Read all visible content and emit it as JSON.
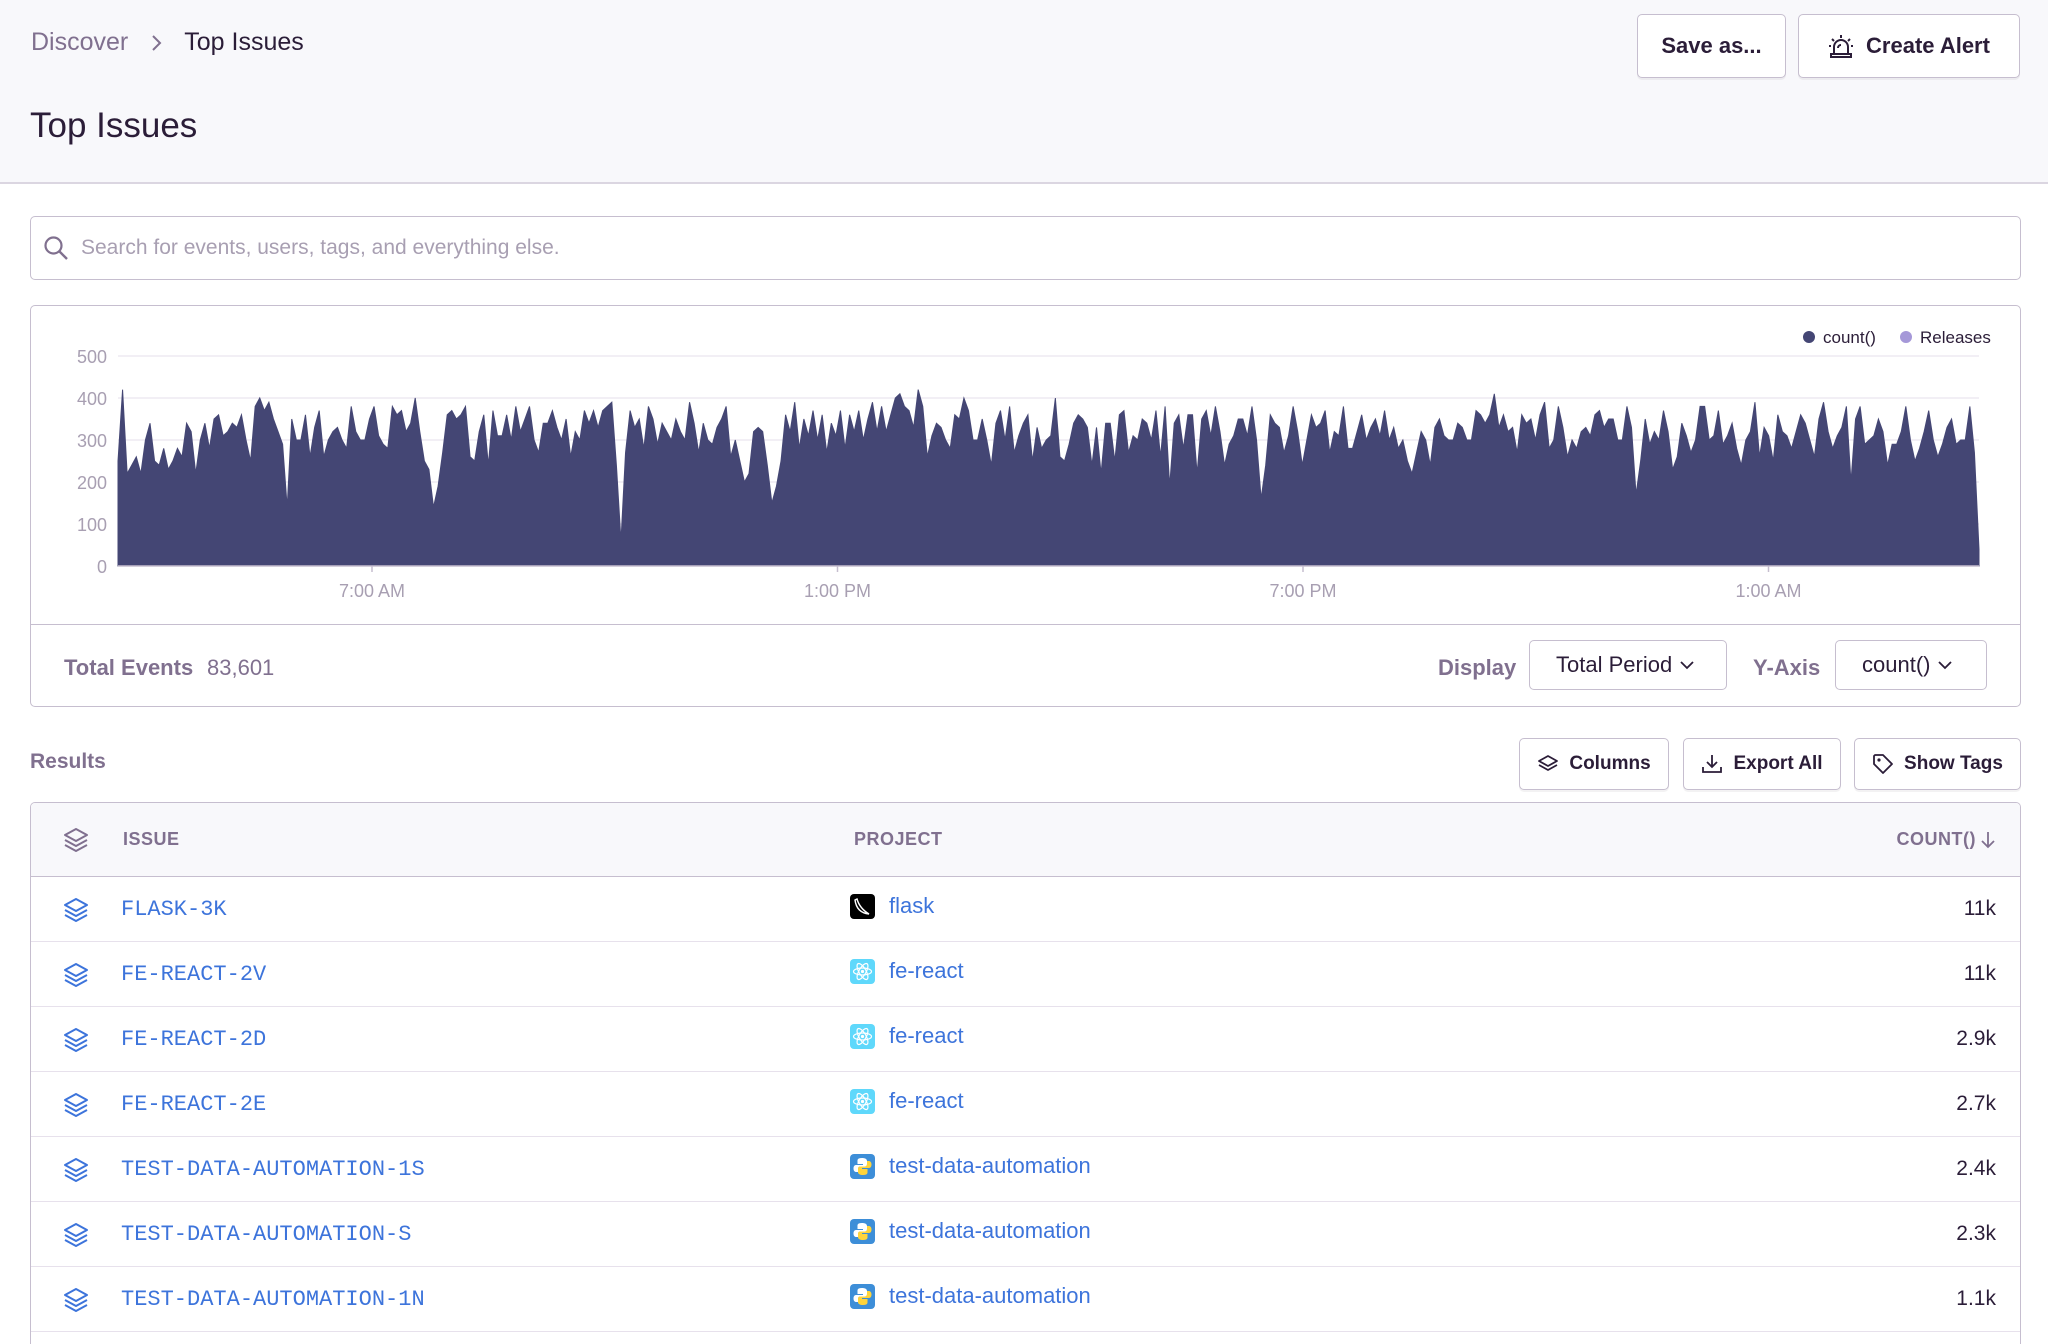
{
  "breadcrumb": {
    "parent": "Discover",
    "current": "Top Issues"
  },
  "page_title": "Top Issues",
  "header_buttons": {
    "save": "Save as...",
    "alert": "Create Alert"
  },
  "search": {
    "placeholder": "Search for events, users, tags, and everything else."
  },
  "chart_data": {
    "type": "area",
    "legend": [
      "count()",
      "Releases"
    ],
    "legend_colors": [
      "#444674",
      "#a598d8"
    ],
    "y_ticks": [
      "500",
      "400",
      "300",
      "200",
      "100",
      "0"
    ],
    "ylim": [
      0,
      500
    ],
    "x_ticks": [
      "7:00 AM",
      "1:00 PM",
      "7:00 PM",
      "1:00 AM"
    ],
    "series": [
      {
        "name": "count()",
        "color": "#444674",
        "values": [
          250,
          420,
          220,
          240,
          260,
          220,
          300,
          340,
          250,
          240,
          280,
          230,
          250,
          280,
          260,
          340,
          320,
          220,
          300,
          340,
          280,
          350,
          360,
          310,
          320,
          340,
          330,
          360,
          300,
          250,
          380,
          400,
          370,
          390,
          350,
          320,
          290,
          140,
          350,
          300,
          300,
          360,
          260,
          330,
          370,
          260,
          300,
          320,
          330,
          300,
          280,
          380,
          320,
          300,
          300,
          350,
          380,
          310,
          290,
          280,
          380,
          360,
          370,
          320,
          340,
          400,
          320,
          250,
          230,
          140,
          190,
          270,
          360,
          370,
          350,
          360,
          380,
          260,
          250,
          320,
          360,
          240,
          370,
          310,
          310,
          360,
          300,
          380,
          320,
          350,
          380,
          300,
          270,
          340,
          340,
          370,
          330,
          300,
          350,
          260,
          320,
          300,
          370,
          340,
          370,
          330,
          370,
          380,
          390,
          240,
          60,
          270,
          370,
          330,
          350,
          280,
          380,
          350,
          290,
          340,
          320,
          300,
          350,
          320,
          300,
          390,
          340,
          270,
          340,
          300,
          290,
          330,
          350,
          380,
          260,
          300,
          250,
          200,
          220,
          320,
          330,
          320,
          240,
          150,
          190,
          250,
          360,
          320,
          390,
          280,
          350,
          310,
          370,
          300,
          360,
          270,
          340,
          310,
          370,
          280,
          360,
          320,
          370,
          300,
          350,
          390,
          320,
          380,
          320,
          360,
          400,
          410,
          380,
          370,
          330,
          420,
          380,
          260,
          310,
          340,
          330,
          300,
          280,
          360,
          350,
          400,
          370,
          300,
          300,
          350,
          300,
          240,
          340,
          370,
          300,
          380,
          270,
          310,
          340,
          360,
          250,
          330,
          280,
          300,
          310,
          400,
          260,
          250,
          290,
          340,
          360,
          350,
          330,
          240,
          330,
          220,
          340,
          340,
          250,
          360,
          370,
          270,
          310,
          300,
          350,
          340,
          300,
          370,
          260,
          380,
          190,
          340,
          360,
          280,
          360,
          360,
          220,
          350,
          370,
          310,
          380,
          320,
          240,
          290,
          310,
          350,
          350,
          310,
          380,
          300,
          160,
          240,
          360,
          340,
          330,
          270,
          310,
          380,
          320,
          240,
          300,
          360,
          330,
          340,
          370,
          270,
          320,
          310,
          380,
          280,
          280,
          320,
          360,
          300,
          330,
          350,
          310,
          370,
          300,
          330,
          280,
          300,
          250,
          220,
          270,
          320,
          300,
          240,
          330,
          350,
          310,
          300,
          300,
          340,
          330,
          300,
          300,
          370,
          360,
          340,
          360,
          410,
          330,
          360,
          320,
          330,
          270,
          360,
          340,
          350,
          300,
          360,
          390,
          280,
          300,
          380,
          330,
          260,
          300,
          280,
          320,
          330,
          310,
          360,
          370,
          330,
          350,
          350,
          300,
          300,
          380,
          330,
          170,
          250,
          350,
          290,
          320,
          300,
          370,
          320,
          230,
          260,
          340,
          310,
          270,
          300,
          380,
          380,
          300,
          310,
          370,
          290,
          310,
          340,
          280,
          240,
          300,
          320,
          390,
          260,
          330,
          310,
          250,
          360,
          320,
          310,
          280,
          320,
          360,
          340,
          300,
          260,
          350,
          390,
          320,
          280,
          310,
          330,
          380,
          200,
          350,
          380,
          290,
          300,
          310,
          350,
          320,
          240,
          290,
          290,
          320,
          380,
          300,
          250,
          280,
          320,
          370,
          300,
          260,
          290,
          330,
          350,
          290,
          300,
          300,
          380,
          270,
          40
        ]
      }
    ]
  },
  "totals": {
    "label": "Total Events",
    "value": "83,601"
  },
  "display": {
    "label": "Display",
    "value": "Total Period"
  },
  "yaxis": {
    "label": "Y-Axis",
    "value": "count()"
  },
  "results": {
    "label": "Results",
    "buttons": {
      "columns": "Columns",
      "export": "Export All",
      "tags": "Show Tags"
    },
    "headers": {
      "issue": "ISSUE",
      "project": "PROJECT",
      "count": "COUNT()"
    },
    "rows": [
      {
        "issue": "FLASK-3K",
        "project": "flask",
        "platform": "flask",
        "count": "11k"
      },
      {
        "issue": "FE-REACT-2V",
        "project": "fe-react",
        "platform": "react",
        "count": "11k"
      },
      {
        "issue": "FE-REACT-2D",
        "project": "fe-react",
        "platform": "react",
        "count": "2.9k"
      },
      {
        "issue": "FE-REACT-2E",
        "project": "fe-react",
        "platform": "react",
        "count": "2.7k"
      },
      {
        "issue": "TEST-DATA-AUTOMATION-1S",
        "project": "test-data-automation",
        "platform": "python",
        "count": "2.4k"
      },
      {
        "issue": "TEST-DATA-AUTOMATION-S",
        "project": "test-data-automation",
        "platform": "python",
        "count": "2.3k"
      },
      {
        "issue": "TEST-DATA-AUTOMATION-1N",
        "project": "test-data-automation",
        "platform": "python",
        "count": "1.1k"
      }
    ]
  },
  "colors": {
    "accent": "#3d74db",
    "chart_fill": "#444674",
    "muted_text": "#80708f",
    "border": "#c6becf"
  }
}
